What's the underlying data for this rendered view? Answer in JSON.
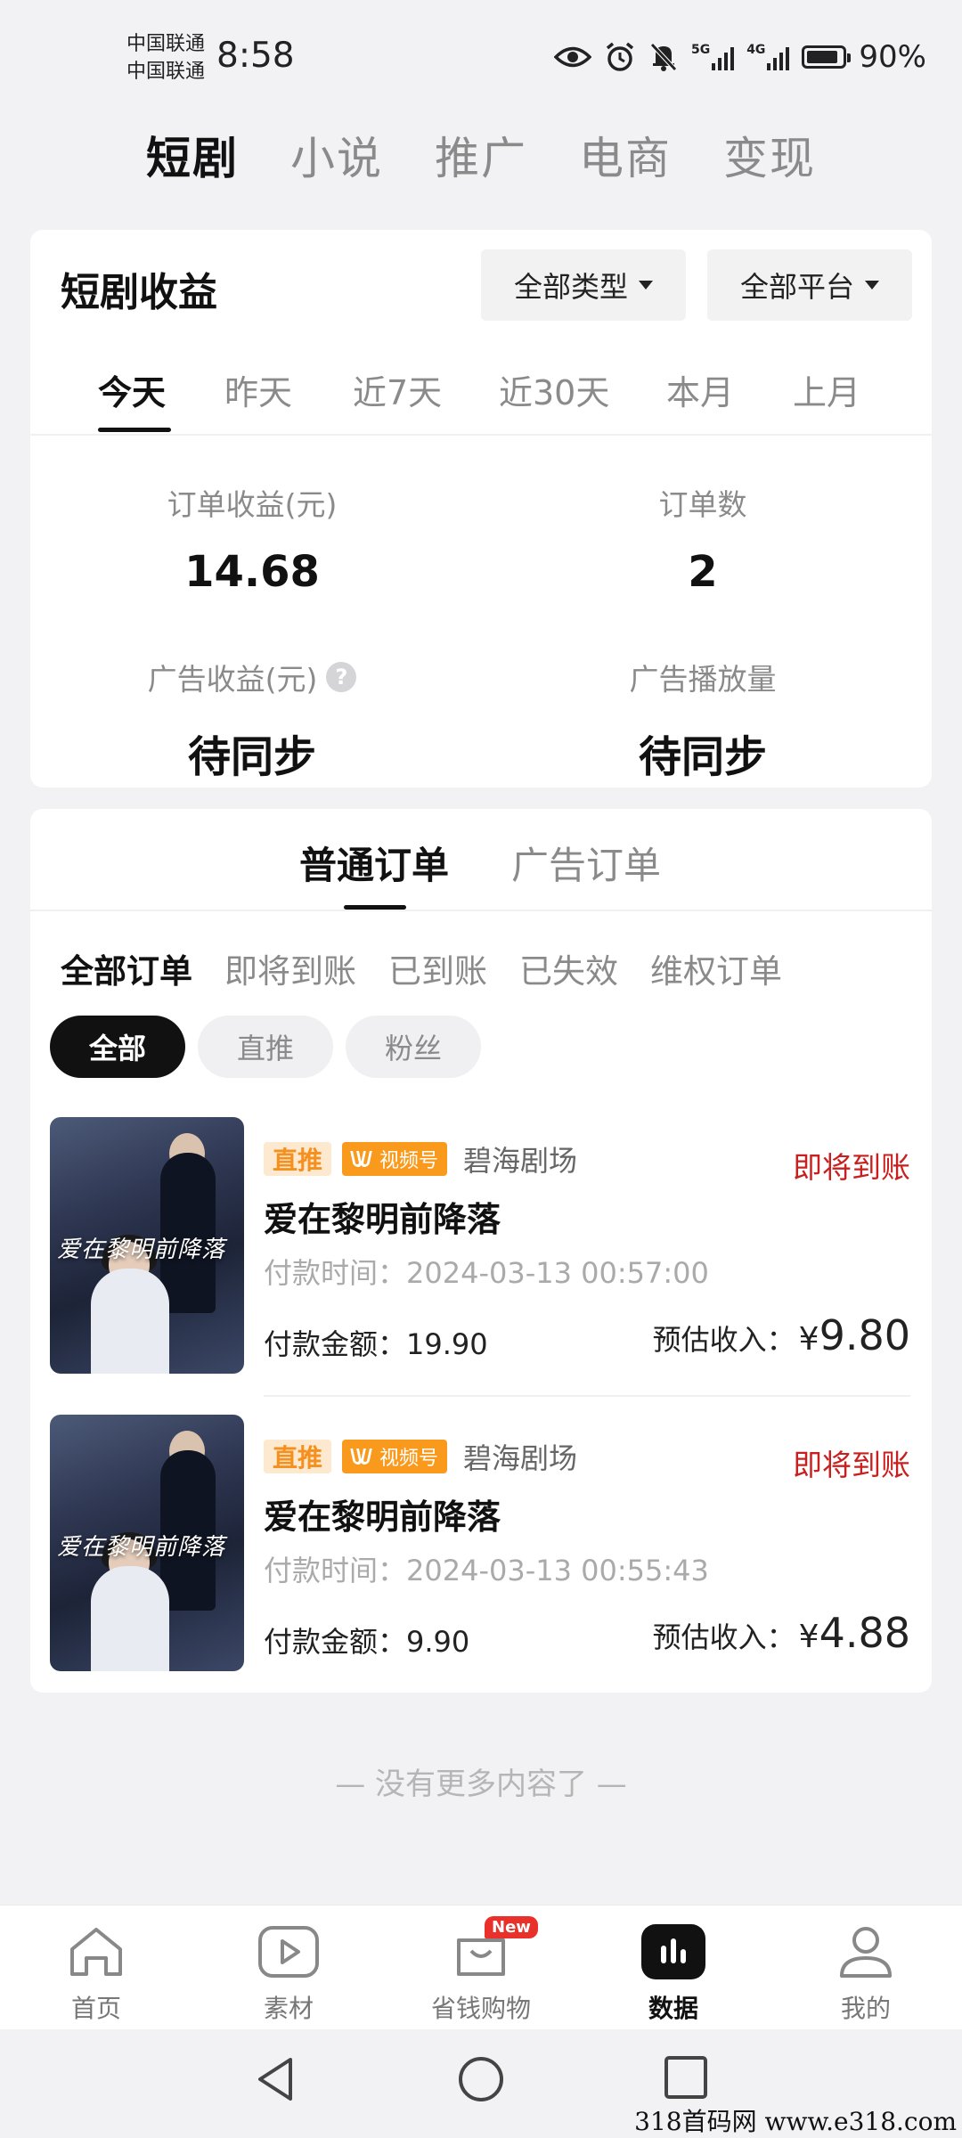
{
  "status_bar": {
    "carrier_1": "中国联通",
    "carrier_2": "中国联通",
    "time": "8:58",
    "net_1": "5G",
    "net_2": "4G",
    "battery": "90%",
    "battery_level": 0.9
  },
  "top_tabs": [
    "短剧",
    "小说",
    "推广",
    "电商",
    "变现"
  ],
  "top_tab_active": 0,
  "earnings": {
    "title": "短剧收益",
    "type_filter": "全部类型",
    "platform_filter": "全部平台",
    "periods": [
      "今天",
      "昨天",
      "近7天",
      "近30天",
      "本月",
      "上月"
    ],
    "period_active": 0,
    "metrics": [
      {
        "label": "订单收益(元)",
        "value": "14.68"
      },
      {
        "label": "订单数",
        "value": "2"
      },
      {
        "label": "广告收益(元)",
        "value": "待同步"
      },
      {
        "label": "广告播放量",
        "value": "待同步"
      }
    ]
  },
  "orders": {
    "type_tabs": [
      "普通订单",
      "广告订单"
    ],
    "type_active": 0,
    "status_tabs": [
      "全部订单",
      "即将到账",
      "已到账",
      "已失效",
      "维权订单"
    ],
    "status_active": 0,
    "source_pills": [
      "全部",
      "直推",
      "粉丝"
    ],
    "pill_active": 0,
    "items": [
      {
        "badge": "直推",
        "channel": "视频号",
        "theater": "碧海剧场",
        "status": "即将到账",
        "title": "爱在黎明前降落",
        "poster_text": "爱在黎明前降落",
        "pay_time": "付款时间：2024-03-13 00:57:00",
        "pay_amount": "付款金额：19.90",
        "est_label": "预估收入：",
        "est_currency": "¥",
        "est_value": "9.80"
      },
      {
        "badge": "直推",
        "channel": "视频号",
        "theater": "碧海剧场",
        "status": "即将到账",
        "title": "爱在黎明前降落",
        "poster_text": "爱在黎明前降落",
        "pay_time": "付款时间：2024-03-13 00:55:43",
        "pay_amount": "付款金额：9.90",
        "est_label": "预估收入：",
        "est_currency": "¥",
        "est_value": "4.88"
      }
    ],
    "end_text": "— 没有更多内容了 —"
  },
  "bottom_nav": {
    "items": [
      {
        "label": "首页",
        "icon": "home-icon"
      },
      {
        "label": "素材",
        "icon": "play-icon"
      },
      {
        "label": "省钱购物",
        "icon": "shopping-bag-icon"
      },
      {
        "label": "数据",
        "icon": "chart-icon"
      },
      {
        "label": "我的",
        "icon": "user-icon"
      }
    ],
    "active": 3,
    "new_badge": "New"
  },
  "watermark": "318首码网 www.e318.com"
}
